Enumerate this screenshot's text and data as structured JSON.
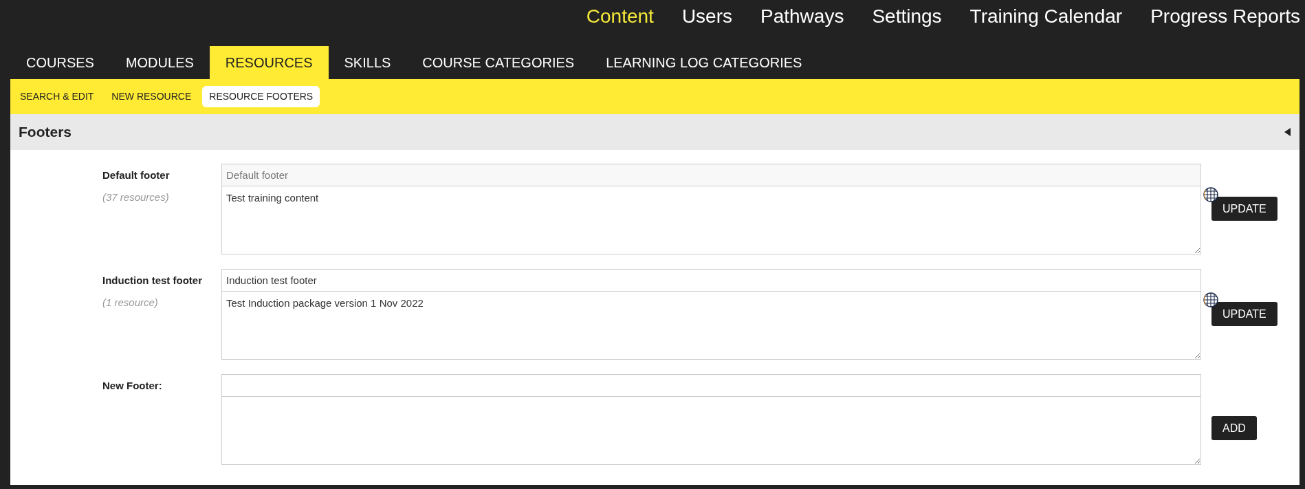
{
  "top_nav": [
    {
      "label": "Content",
      "selected": true
    },
    {
      "label": "Users",
      "selected": false
    },
    {
      "label": "Pathways",
      "selected": false
    },
    {
      "label": "Settings",
      "selected": false
    },
    {
      "label": "Training Calendar",
      "selected": false
    },
    {
      "label": "Progress Reports",
      "selected": false
    }
  ],
  "tabs": [
    {
      "label": "COURSES",
      "selected": false
    },
    {
      "label": "MODULES",
      "selected": false
    },
    {
      "label": "RESOURCES",
      "selected": true
    },
    {
      "label": "SKILLS",
      "selected": false
    },
    {
      "label": "COURSE CATEGORIES",
      "selected": false
    },
    {
      "label": "LEARNING LOG CATEGORIES",
      "selected": false
    }
  ],
  "sub_tabs": [
    {
      "label": "SEARCH & EDIT",
      "selected": false
    },
    {
      "label": "NEW RESOURCE",
      "selected": false
    },
    {
      "label": "RESOURCE FOOTERS",
      "selected": true
    }
  ],
  "section": {
    "title": "Footers",
    "expanded": false
  },
  "footers": [
    {
      "kind": "existing",
      "label": "Default footer",
      "count": "(37 resources)",
      "name_value": "Default footer",
      "name_disabled": true,
      "body_value": "Test training content",
      "button": "UPDATE"
    },
    {
      "kind": "existing",
      "label": "Induction test footer",
      "count": "(1 resource)",
      "name_value": "Induction test footer",
      "name_disabled": false,
      "body_value": "Test Induction package version 1 Nov 2022",
      "button": "UPDATE"
    },
    {
      "kind": "new",
      "label": "New Footer:",
      "button": "ADD"
    }
  ]
}
